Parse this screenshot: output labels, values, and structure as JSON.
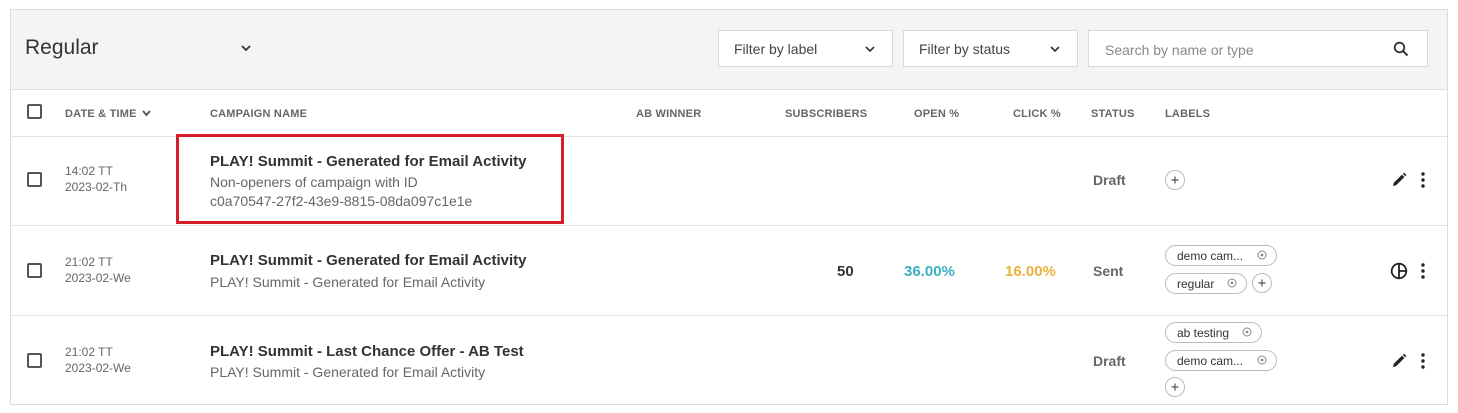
{
  "header": {
    "view_title": "Regular",
    "filter_label": "Filter by label",
    "filter_status": "Filter by status",
    "search_placeholder": "Search by name or type"
  },
  "columns": {
    "date_time": "DATE & TIME",
    "campaign_name": "CAMPAIGN NAME",
    "ab_winner": "AB WINNER",
    "subscribers": "SUBSCRIBERS",
    "open_pct": "OPEN %",
    "click_pct": "CLICK %",
    "status": "STATUS",
    "labels": "LABELS"
  },
  "colors": {
    "open": "#3ab0c3",
    "click": "#e8b23a",
    "highlight": "#d71f2a"
  },
  "rows": [
    {
      "time": "14:02 TT",
      "date": "2023-02-Th",
      "name": "PLAY! Summit - Generated for Email Activity",
      "sub_line1": "Non-openers of campaign with ID",
      "sub_line2": "c0a70547-27f2-43e9-8815-08da097c1e1e",
      "status": "Draft",
      "labels": []
    },
    {
      "time": "21:02 TT",
      "date": "2023-02-We",
      "name": "PLAY! Summit - Generated for Email Activity",
      "sub_line1": "PLAY! Summit - Generated for Email Activity",
      "subscribers": "50",
      "open": "36.00%",
      "click": "16.00%",
      "status": "Sent",
      "labels": [
        "demo cam...",
        "regular"
      ]
    },
    {
      "time": "21:02 TT",
      "date": "2023-02-We",
      "name": "PLAY! Summit - Last Chance Offer - AB Test",
      "sub_line1": "PLAY! Summit - Generated for Email Activity",
      "status": "Draft",
      "labels": [
        "ab testing",
        "demo cam..."
      ]
    }
  ]
}
